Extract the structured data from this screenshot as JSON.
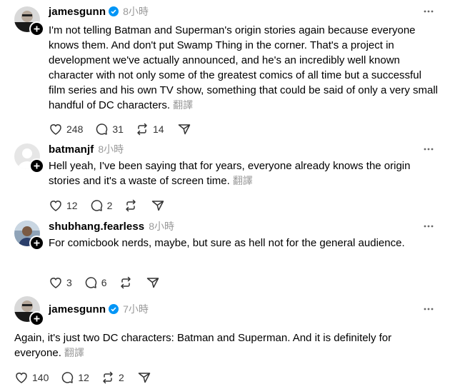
{
  "posts": [
    {
      "username": "jamesgunn",
      "verified": true,
      "time": "8小時",
      "text": "I'm not telling Batman and Superman's origin stories again because everyone knows them. And don't put Swamp Thing in the corner. That's a project in development we've actually announced, and he's an incredibly well known character with not only some of the greatest comics of all time but a successful film series and his own TV show, something that could be said of only a very small handful of DC characters.",
      "translate": "翻譯",
      "likes": "248",
      "comments": "31",
      "reposts": "14"
    },
    {
      "username": "batmanjf",
      "verified": false,
      "time": "8小時",
      "text": "Hell yeah, I've been saying that for years, everyone already knows the origin stories and it's a waste of screen time.",
      "translate": "翻譯",
      "likes": "12",
      "comments": "2",
      "reposts": ""
    },
    {
      "username": "shubhang.fearless",
      "verified": false,
      "time": "8小時",
      "text": "For comicbook nerds, maybe, but sure as hell not for the general audience.",
      "translate": "",
      "likes": "3",
      "comments": "6",
      "reposts": ""
    },
    {
      "username": "jamesgunn",
      "verified": true,
      "time": "7小時",
      "text": "Again, it's just two DC characters: Batman and Superman. And it is definitely for everyone.",
      "translate": "翻譯",
      "likes": "140",
      "comments": "12",
      "reposts": "2"
    }
  ],
  "colors": {
    "text": "#000000",
    "muted": "#999999",
    "verified": "#0095f6",
    "icon": "#333333"
  },
  "icons": [
    "plus-icon",
    "verified-icon",
    "more-icon",
    "heart-icon",
    "comment-icon",
    "repost-icon",
    "share-icon"
  ]
}
